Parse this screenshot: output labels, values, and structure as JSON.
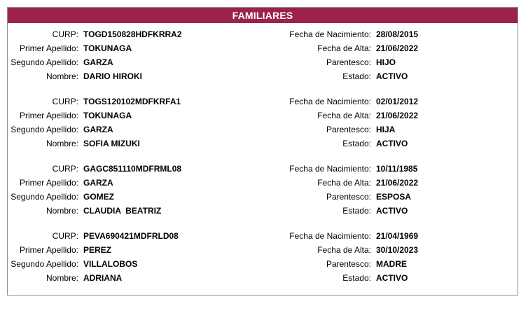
{
  "header": {
    "title": "FAMILIARES"
  },
  "labels": {
    "curp": "CURP:",
    "primer_apellido": "Primer Apellido:",
    "segundo_apellido": "Segundo Apellido:",
    "nombre": "Nombre:",
    "fecha_nacimiento": "Fecha de Nacimiento:",
    "fecha_alta": "Fecha de Alta:",
    "parentesco": "Parentesco:",
    "estado": "Estado:"
  },
  "familiares": [
    {
      "curp": "TOGD150828HDFKRRA2",
      "primer_apellido": "TOKUNAGA",
      "segundo_apellido": "GARZA",
      "nombre": "DARIO HIROKI",
      "fecha_nacimiento": "28/08/2015",
      "fecha_alta": "21/06/2022",
      "parentesco": "HIJO",
      "estado": "ACTIVO"
    },
    {
      "curp": "TOGS120102MDFKRFA1",
      "primer_apellido": "TOKUNAGA",
      "segundo_apellido": "GARZA",
      "nombre": "SOFIA MIZUKI",
      "fecha_nacimiento": "02/01/2012",
      "fecha_alta": "21/06/2022",
      "parentesco": "HIJA",
      "estado": "ACTIVO"
    },
    {
      "curp": "GAGC851110MDFRML08",
      "primer_apellido": "GARZA",
      "segundo_apellido": "GOMEZ",
      "nombre": "CLAUDIA  BEATRIZ",
      "fecha_nacimiento": "10/11/1985",
      "fecha_alta": "21/06/2022",
      "parentesco": "ESPOSA",
      "estado": "ACTIVO"
    },
    {
      "curp": "PEVA690421MDFRLD08",
      "primer_apellido": "PEREZ",
      "segundo_apellido": "VILLALOBOS",
      "nombre": "ADRIANA",
      "fecha_nacimiento": "21/04/1969",
      "fecha_alta": "30/10/2023",
      "parentesco": "MADRE",
      "estado": "ACTIVO"
    }
  ],
  "colors": {
    "header_background": "#9c2348",
    "header_text": "#ffffff",
    "border": "#8f8f8f"
  }
}
